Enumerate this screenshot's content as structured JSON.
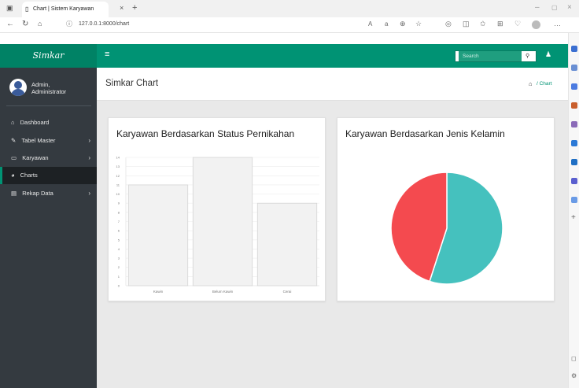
{
  "browser": {
    "tab_title": "Chart | Sistem Karyawan",
    "tab_close": "×",
    "new_tab": "+",
    "url": "127.0.0.1:8000/chart",
    "minimize": "–",
    "maximize": "▢",
    "close": "×"
  },
  "app": {
    "brand": "Simkar",
    "search_placeholder": "Search",
    "user_name": "Admin,",
    "user_role": "Administrator",
    "page_title": "Simkar Chart",
    "breadcrumb_current": "/ Chart"
  },
  "sidebar": {
    "items": [
      {
        "label": "Dashboard",
        "icon": "dashboard-icon",
        "has_children": false,
        "active": false
      },
      {
        "label": "Tabel Master",
        "icon": "edit-icon",
        "has_children": true,
        "active": false
      },
      {
        "label": "Karyawan",
        "icon": "laptop-icon",
        "has_children": true,
        "active": false
      },
      {
        "label": "Charts",
        "icon": "pie-icon",
        "has_children": false,
        "active": true
      },
      {
        "label": "Rekap Data",
        "icon": "file-icon",
        "has_children": true,
        "active": false
      }
    ]
  },
  "colors": {
    "primary": "#009374",
    "sidebar": "#343a40",
    "active_item": "#1d2124",
    "pie_red": "#f44a4f",
    "pie_teal": "#45c1be"
  },
  "chart_data": [
    {
      "type": "bar",
      "title": "Karyawan Berdasarkan Status Pernikahan",
      "categories": [
        "Kawin",
        "Belum Kawin",
        "Cerai"
      ],
      "values": [
        11,
        14,
        9
      ],
      "ylim": [
        0,
        14
      ],
      "yticks": [
        "0",
        "1",
        "2",
        "3",
        "4",
        "5",
        "6",
        "7",
        "8",
        "9",
        "10",
        "11",
        "12",
        "13",
        "14"
      ],
      "grid": true
    },
    {
      "type": "pie",
      "title": "Karyawan Berdasarkan Jenis Kelamin",
      "values": [
        55,
        45
      ]
    }
  ]
}
